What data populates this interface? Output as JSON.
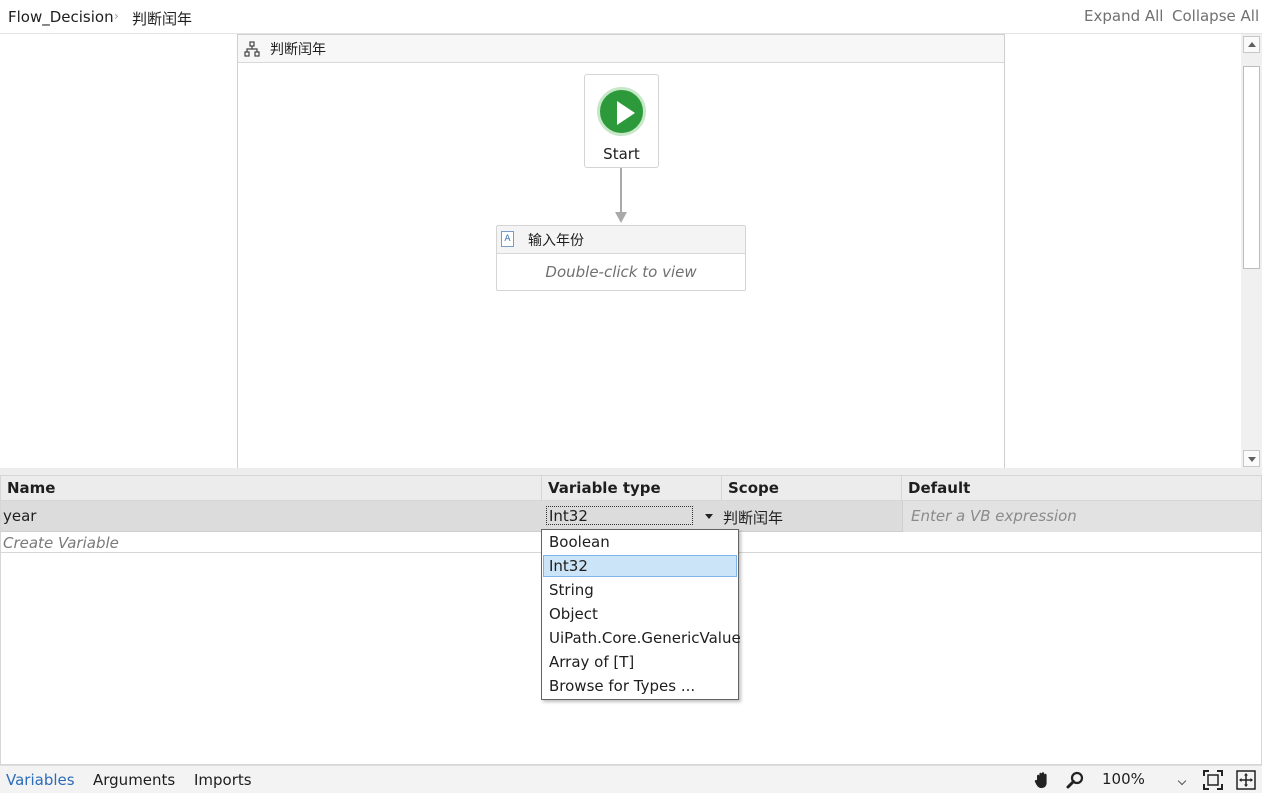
{
  "breadcrumb": {
    "items": [
      "Flow_Decision",
      "判断闰年"
    ],
    "separator": "›"
  },
  "header_actions": {
    "expand_all": "Expand All",
    "collapse_all": "Collapse All"
  },
  "flowchart": {
    "title": "判断闰年",
    "start_label": "Start",
    "activity": {
      "title": "输入年份",
      "body": "Double-click to view"
    }
  },
  "variables_grid": {
    "columns": [
      "Name",
      "Variable type",
      "Scope",
      "Default"
    ],
    "rows": [
      {
        "name": "year",
        "type": "Int32",
        "scope": "判断闰年",
        "default_placeholder": "Enter a VB expression"
      }
    ],
    "create_label": "Create Variable"
  },
  "type_dropdown": {
    "options": [
      "Boolean",
      "Int32",
      "String",
      "Object",
      "UiPath.Core.GenericValue",
      "Array of [T]",
      "Browse for Types ..."
    ],
    "selected": "Int32"
  },
  "bottom_tabs": {
    "variables": "Variables",
    "arguments": "Arguments",
    "imports": "Imports",
    "active": "Variables"
  },
  "zoom": {
    "value": "100%"
  },
  "colors": {
    "start_green": "#2c9a3a",
    "active_tab": "#2b6cb8",
    "selection": "#cce4f7"
  }
}
